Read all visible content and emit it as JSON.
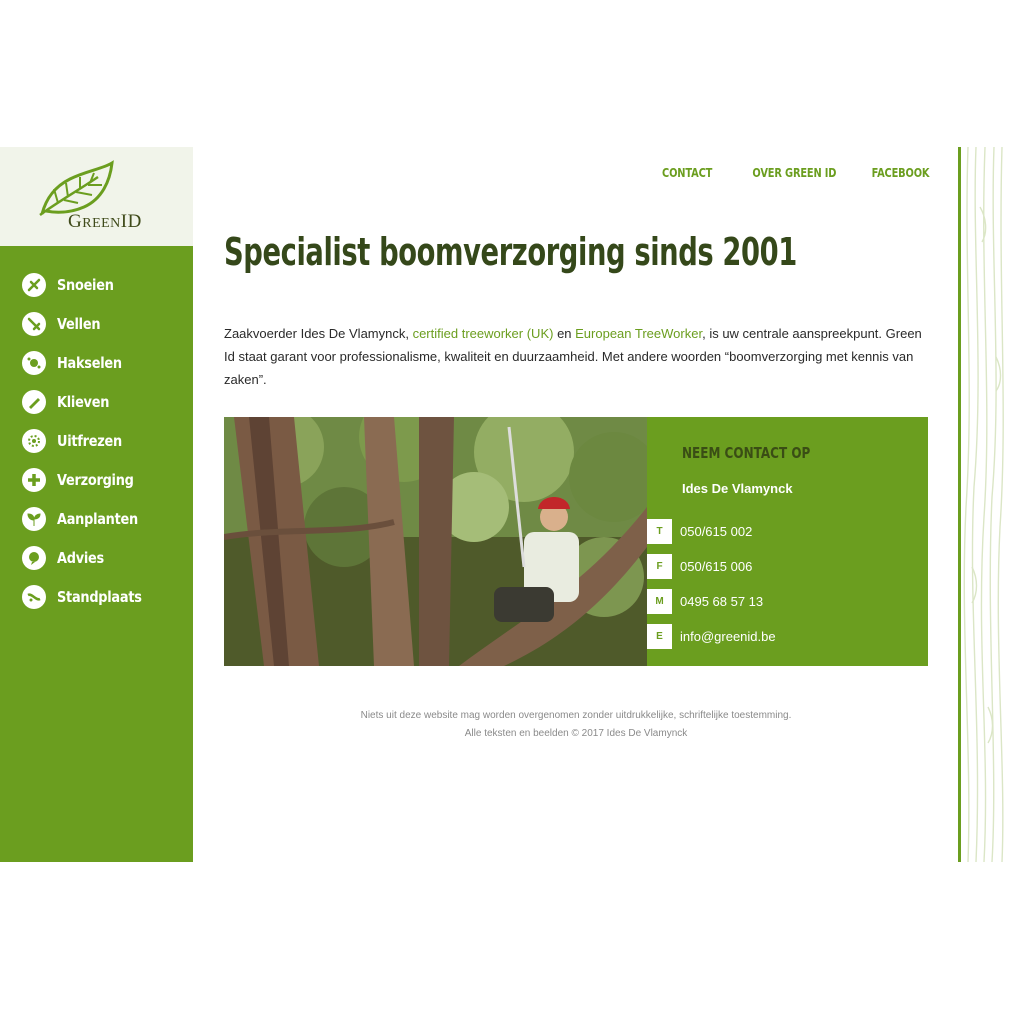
{
  "brand": {
    "logo_text_big": "G",
    "logo_text_rest": "REEN",
    "logo_text_id": "ID",
    "colors": {
      "primary": "#6b9e1f",
      "dark": "#35481a",
      "logo_bg": "#f1f4ea"
    }
  },
  "sidebar": {
    "items": [
      {
        "label": "Snoeien",
        "icon": "pruning-icon"
      },
      {
        "label": "Vellen",
        "icon": "felling-icon"
      },
      {
        "label": "Hakselen",
        "icon": "chipping-icon"
      },
      {
        "label": "Klieven",
        "icon": "splitting-icon"
      },
      {
        "label": "Uitfrezen",
        "icon": "stump-grinding-icon"
      },
      {
        "label": "Verzorging",
        "icon": "plus-icon"
      },
      {
        "label": "Aanplanten",
        "icon": "planting-icon"
      },
      {
        "label": "Advies",
        "icon": "advice-icon"
      },
      {
        "label": "Standplaats",
        "icon": "location-icon"
      }
    ]
  },
  "topnav": {
    "contact": "CONTACT",
    "about": "OVER GREEN ID",
    "facebook": "FACEBOOK"
  },
  "main": {
    "title": "Specialist boomverzorging sinds 2001",
    "intro": {
      "before": "Zaakvoerder Ides De Vlamynck, ",
      "link1": "certified treeworker (UK)",
      "mid": " en ",
      "link2": "European TreeWorker",
      "after": ", is uw centrale aanspreekpunt. Green Id staat garant voor professionalisme, kwaliteit en duurzaamheid. Met andere woorden “boomverzorging met kennis van zaken”."
    }
  },
  "contact": {
    "heading": "NEEM CONTACT OP",
    "name": "Ides De Vlamynck",
    "rows": [
      {
        "letter": "T",
        "value": "050/615 002"
      },
      {
        "letter": "F",
        "value": "050/615 006"
      },
      {
        "letter": "M",
        "value": "0495 68 57 13"
      },
      {
        "letter": "E",
        "value": "info@greenid.be"
      }
    ]
  },
  "footer": {
    "line1": "Niets uit deze website mag worden overgenomen zonder uitdrukkelijke, schriftelijke toestemming.",
    "line2": "Alle teksten en beelden © 2017 Ides De Vlamynck"
  }
}
